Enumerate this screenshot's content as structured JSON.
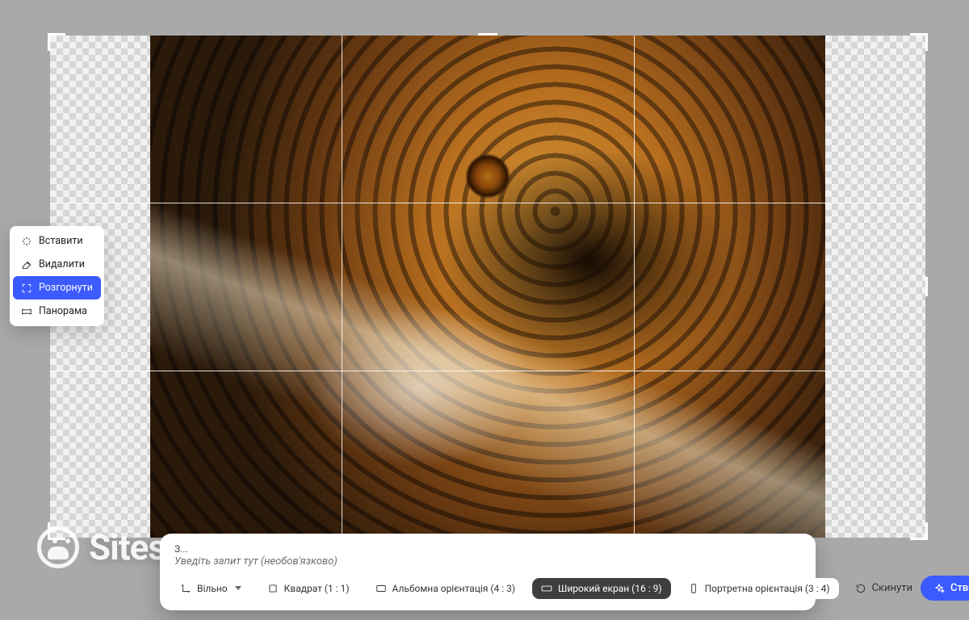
{
  "context_menu": {
    "items": [
      {
        "label": "Вставити",
        "icon": "sparkle-insert-icon",
        "active": false
      },
      {
        "label": "Видалити",
        "icon": "sparkle-erase-icon",
        "active": false
      },
      {
        "label": "Розгорнути",
        "icon": "expand-icon",
        "active": true
      },
      {
        "label": "Панорама",
        "icon": "panorama-icon",
        "active": false
      }
    ]
  },
  "watermark": {
    "text": "Siteset"
  },
  "prompt_bar": {
    "label_short": "З...",
    "placeholder": "Уведіть запит тут (необов'язково)"
  },
  "aspect_options": [
    {
      "label": "Вільно",
      "icon": "crop-free-icon",
      "has_dropdown": true,
      "selected": false
    },
    {
      "label": "Квадрат (1 : 1)",
      "icon": "square-icon",
      "has_dropdown": false,
      "selected": false
    },
    {
      "label": "Альбомна орієнтація (4 : 3)",
      "icon": "landscape-icon",
      "has_dropdown": false,
      "selected": false
    },
    {
      "label": "Широкий екран (16 : 9)",
      "icon": "widescreen-icon",
      "has_dropdown": false,
      "selected": true
    },
    {
      "label": "Портретна орієнтація (3 : 4)",
      "icon": "portrait-icon",
      "has_dropdown": false,
      "selected": false
    }
  ],
  "actions": {
    "reset": "Скинути",
    "create": "Створити"
  }
}
